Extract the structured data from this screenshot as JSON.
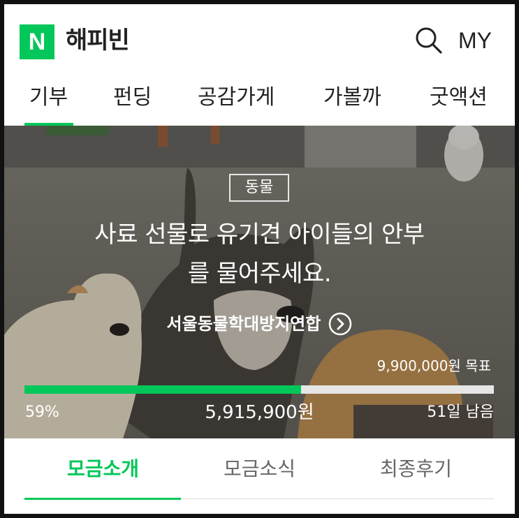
{
  "header": {
    "logo_letter": "N",
    "brand": "해피빈",
    "my_label": "MY",
    "accent": "#03c75a"
  },
  "nav": {
    "items": [
      {
        "label": "기부",
        "active": true
      },
      {
        "label": "펀딩",
        "active": false
      },
      {
        "label": "공감가게",
        "active": false
      },
      {
        "label": "가볼까",
        "active": false
      },
      {
        "label": "굿액션",
        "active": false
      }
    ]
  },
  "campaign": {
    "category": "동물",
    "title_line1": "사료 선물로 유기견 아이들의 안부",
    "title_line2": "를 물어주세요.",
    "organization": "서울동물학대방지연합",
    "goal": "9,900,000원 목표",
    "progress_percent": 59,
    "progress_label": "59%",
    "raised": "5,915,900원",
    "days_left": "51일 남음"
  },
  "subtabs": {
    "items": [
      {
        "label": "모금소개",
        "active": true
      },
      {
        "label": "모금소식",
        "active": false
      },
      {
        "label": "최종후기",
        "active": false
      }
    ]
  }
}
